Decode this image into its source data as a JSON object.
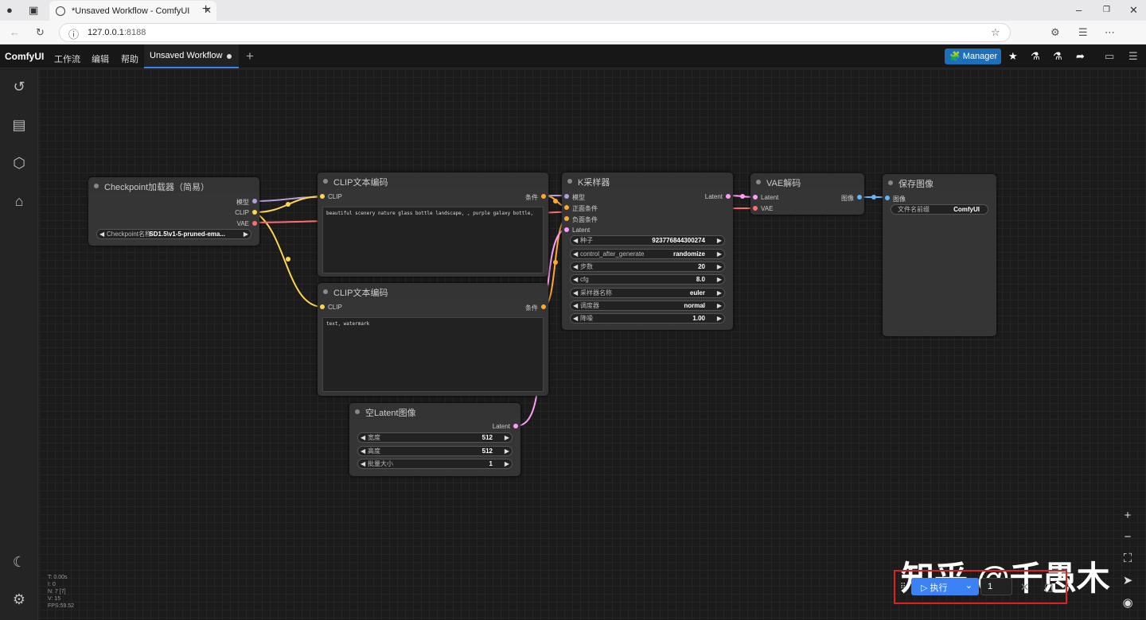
{
  "browser": {
    "tab_title": "*Unsaved Workflow - ComfyUI",
    "url_host": "127.0.0.1",
    "url_port": ":8188"
  },
  "app": {
    "brand": "ComfyUI",
    "menu": [
      "工作流",
      "编辑",
      "帮助"
    ],
    "workflow_tab": "Unsaved Workflow",
    "manager_label": "Manager"
  },
  "nodes": {
    "checkpoint": {
      "title": "Checkpoint加载器（简易）",
      "outputs": [
        "模型",
        "CLIP",
        "VAE"
      ],
      "widget_label": "Checkpoint名称",
      "widget_value": "SD1.5\\v1-5-pruned-ema..."
    },
    "clip_pos": {
      "title": "CLIP文本编码",
      "input": "CLIP",
      "output": "条件",
      "text": "beautiful scenery nature glass bottle landscape, , purple galaxy bottle,"
    },
    "clip_neg": {
      "title": "CLIP文本编码",
      "input": "CLIP",
      "output": "条件",
      "text": "text, watermark"
    },
    "ksampler": {
      "title": "K采样器",
      "inputs": [
        "模型",
        "正面条件",
        "负面条件",
        "Latent"
      ],
      "output": "Latent",
      "widgets": [
        {
          "label": "种子",
          "value": "923776844300274"
        },
        {
          "label": "control_after_generate",
          "value": "randomize"
        },
        {
          "label": "步数",
          "value": "20"
        },
        {
          "label": "cfg",
          "value": "8.0"
        },
        {
          "label": "采样器名称",
          "value": "euler"
        },
        {
          "label": "调度器",
          "value": "normal"
        },
        {
          "label": "降噪",
          "value": "1.00"
        }
      ]
    },
    "vae": {
      "title": "VAE解码",
      "inputs": [
        "Latent",
        "VAE"
      ],
      "output": "图像"
    },
    "save": {
      "title": "保存图像",
      "input": "图像",
      "widget_label": "文件名前缀",
      "widget_value": "ComfyUI"
    },
    "latent": {
      "title": "空Latent图像",
      "output": "Latent",
      "widgets": [
        {
          "label": "宽度",
          "value": "512"
        },
        {
          "label": "高度",
          "value": "512"
        },
        {
          "label": "批量大小",
          "value": "1"
        }
      ]
    }
  },
  "stats": [
    "T: 0.00s",
    "I: 0",
    "N: 7 [7]",
    "V: 15",
    "FPS:59.52"
  ],
  "queue": {
    "run_label": "执行",
    "count": "1"
  },
  "watermark": "知乎 @千愚木",
  "colors": {
    "model_wire": "#b39ddb",
    "clip_wire": "#ffd54f",
    "vae_wire": "#ff6e6e",
    "cond_wire": "#ffa931",
    "latent_wire": "#ff9cf9",
    "image_wire": "#64b5f6",
    "accent": "#3b82f6"
  }
}
